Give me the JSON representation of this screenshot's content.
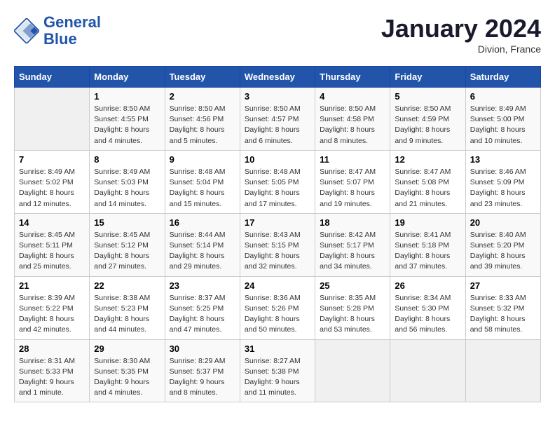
{
  "header": {
    "logo_line1": "General",
    "logo_line2": "Blue",
    "month_title": "January 2024",
    "subtitle": "Divion, France"
  },
  "days_of_week": [
    "Sunday",
    "Monday",
    "Tuesday",
    "Wednesday",
    "Thursday",
    "Friday",
    "Saturday"
  ],
  "weeks": [
    [
      {
        "day": "",
        "sunrise": "",
        "sunset": "",
        "daylight": ""
      },
      {
        "day": "1",
        "sunrise": "Sunrise: 8:50 AM",
        "sunset": "Sunset: 4:55 PM",
        "daylight": "Daylight: 8 hours and 4 minutes."
      },
      {
        "day": "2",
        "sunrise": "Sunrise: 8:50 AM",
        "sunset": "Sunset: 4:56 PM",
        "daylight": "Daylight: 8 hours and 5 minutes."
      },
      {
        "day": "3",
        "sunrise": "Sunrise: 8:50 AM",
        "sunset": "Sunset: 4:57 PM",
        "daylight": "Daylight: 8 hours and 6 minutes."
      },
      {
        "day": "4",
        "sunrise": "Sunrise: 8:50 AM",
        "sunset": "Sunset: 4:58 PM",
        "daylight": "Daylight: 8 hours and 8 minutes."
      },
      {
        "day": "5",
        "sunrise": "Sunrise: 8:50 AM",
        "sunset": "Sunset: 4:59 PM",
        "daylight": "Daylight: 8 hours and 9 minutes."
      },
      {
        "day": "6",
        "sunrise": "Sunrise: 8:49 AM",
        "sunset": "Sunset: 5:00 PM",
        "daylight": "Daylight: 8 hours and 10 minutes."
      }
    ],
    [
      {
        "day": "7",
        "sunrise": "Sunrise: 8:49 AM",
        "sunset": "Sunset: 5:02 PM",
        "daylight": "Daylight: 8 hours and 12 minutes."
      },
      {
        "day": "8",
        "sunrise": "Sunrise: 8:49 AM",
        "sunset": "Sunset: 5:03 PM",
        "daylight": "Daylight: 8 hours and 14 minutes."
      },
      {
        "day": "9",
        "sunrise": "Sunrise: 8:48 AM",
        "sunset": "Sunset: 5:04 PM",
        "daylight": "Daylight: 8 hours and 15 minutes."
      },
      {
        "day": "10",
        "sunrise": "Sunrise: 8:48 AM",
        "sunset": "Sunset: 5:05 PM",
        "daylight": "Daylight: 8 hours and 17 minutes."
      },
      {
        "day": "11",
        "sunrise": "Sunrise: 8:47 AM",
        "sunset": "Sunset: 5:07 PM",
        "daylight": "Daylight: 8 hours and 19 minutes."
      },
      {
        "day": "12",
        "sunrise": "Sunrise: 8:47 AM",
        "sunset": "Sunset: 5:08 PM",
        "daylight": "Daylight: 8 hours and 21 minutes."
      },
      {
        "day": "13",
        "sunrise": "Sunrise: 8:46 AM",
        "sunset": "Sunset: 5:09 PM",
        "daylight": "Daylight: 8 hours and 23 minutes."
      }
    ],
    [
      {
        "day": "14",
        "sunrise": "Sunrise: 8:45 AM",
        "sunset": "Sunset: 5:11 PM",
        "daylight": "Daylight: 8 hours and 25 minutes."
      },
      {
        "day": "15",
        "sunrise": "Sunrise: 8:45 AM",
        "sunset": "Sunset: 5:12 PM",
        "daylight": "Daylight: 8 hours and 27 minutes."
      },
      {
        "day": "16",
        "sunrise": "Sunrise: 8:44 AM",
        "sunset": "Sunset: 5:14 PM",
        "daylight": "Daylight: 8 hours and 29 minutes."
      },
      {
        "day": "17",
        "sunrise": "Sunrise: 8:43 AM",
        "sunset": "Sunset: 5:15 PM",
        "daylight": "Daylight: 8 hours and 32 minutes."
      },
      {
        "day": "18",
        "sunrise": "Sunrise: 8:42 AM",
        "sunset": "Sunset: 5:17 PM",
        "daylight": "Daylight: 8 hours and 34 minutes."
      },
      {
        "day": "19",
        "sunrise": "Sunrise: 8:41 AM",
        "sunset": "Sunset: 5:18 PM",
        "daylight": "Daylight: 8 hours and 37 minutes."
      },
      {
        "day": "20",
        "sunrise": "Sunrise: 8:40 AM",
        "sunset": "Sunset: 5:20 PM",
        "daylight": "Daylight: 8 hours and 39 minutes."
      }
    ],
    [
      {
        "day": "21",
        "sunrise": "Sunrise: 8:39 AM",
        "sunset": "Sunset: 5:22 PM",
        "daylight": "Daylight: 8 hours and 42 minutes."
      },
      {
        "day": "22",
        "sunrise": "Sunrise: 8:38 AM",
        "sunset": "Sunset: 5:23 PM",
        "daylight": "Daylight: 8 hours and 44 minutes."
      },
      {
        "day": "23",
        "sunrise": "Sunrise: 8:37 AM",
        "sunset": "Sunset: 5:25 PM",
        "daylight": "Daylight: 8 hours and 47 minutes."
      },
      {
        "day": "24",
        "sunrise": "Sunrise: 8:36 AM",
        "sunset": "Sunset: 5:26 PM",
        "daylight": "Daylight: 8 hours and 50 minutes."
      },
      {
        "day": "25",
        "sunrise": "Sunrise: 8:35 AM",
        "sunset": "Sunset: 5:28 PM",
        "daylight": "Daylight: 8 hours and 53 minutes."
      },
      {
        "day": "26",
        "sunrise": "Sunrise: 8:34 AM",
        "sunset": "Sunset: 5:30 PM",
        "daylight": "Daylight: 8 hours and 56 minutes."
      },
      {
        "day": "27",
        "sunrise": "Sunrise: 8:33 AM",
        "sunset": "Sunset: 5:32 PM",
        "daylight": "Daylight: 8 hours and 58 minutes."
      }
    ],
    [
      {
        "day": "28",
        "sunrise": "Sunrise: 8:31 AM",
        "sunset": "Sunset: 5:33 PM",
        "daylight": "Daylight: 9 hours and 1 minute."
      },
      {
        "day": "29",
        "sunrise": "Sunrise: 8:30 AM",
        "sunset": "Sunset: 5:35 PM",
        "daylight": "Daylight: 9 hours and 4 minutes."
      },
      {
        "day": "30",
        "sunrise": "Sunrise: 8:29 AM",
        "sunset": "Sunset: 5:37 PM",
        "daylight": "Daylight: 9 hours and 8 minutes."
      },
      {
        "day": "31",
        "sunrise": "Sunrise: 8:27 AM",
        "sunset": "Sunset: 5:38 PM",
        "daylight": "Daylight: 9 hours and 11 minutes."
      },
      {
        "day": "",
        "sunrise": "",
        "sunset": "",
        "daylight": ""
      },
      {
        "day": "",
        "sunrise": "",
        "sunset": "",
        "daylight": ""
      },
      {
        "day": "",
        "sunrise": "",
        "sunset": "",
        "daylight": ""
      }
    ]
  ]
}
